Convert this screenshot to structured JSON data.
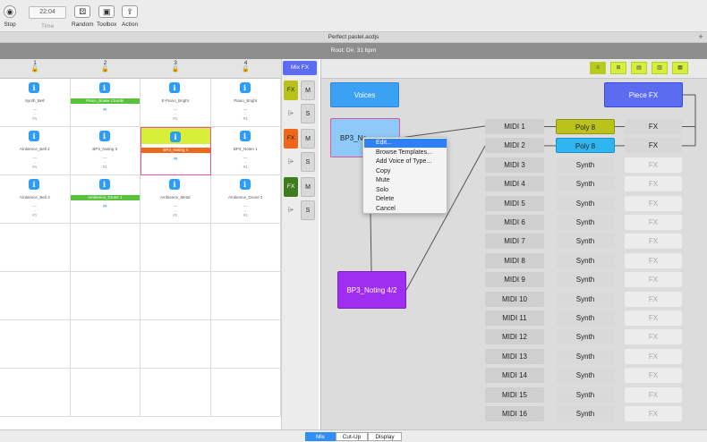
{
  "toolbar": {
    "stop_label": "Stop",
    "time_value": "22:04",
    "time_label": "Time",
    "random_label": "Random",
    "toolbox_label": "Toolbox",
    "action_label": "Action"
  },
  "title": "Perfect pastel.acdjs",
  "root": "Root: D#, 31 bpm",
  "plus": "+",
  "grid": {
    "columns": [
      {
        "num": "1",
        "lock": "🔓"
      },
      {
        "num": "2",
        "lock": "🔓"
      },
      {
        "num": "3",
        "lock": "🔒"
      },
      {
        "num": "4",
        "lock": "🔓"
      }
    ],
    "cells": [
      {
        "name": "Synth_Bell",
        "marks": [
          "—",
          "◦",
          "#1"
        ]
      },
      {
        "name": "Piano_Bowie Chords",
        "style": "g",
        "loop": "∞"
      },
      {
        "name": "E-Piano_Bright",
        "marks": [
          "—",
          "◦",
          "#1"
        ]
      },
      {
        "name": "Piano_Bright",
        "marks": [
          "—",
          "◦",
          "#1"
        ]
      },
      {
        "name": "Ambience_Bell 2",
        "marks": [
          "—",
          "◦",
          "#1"
        ]
      },
      {
        "name": "BP3_Noting 3",
        "marks": [
          "—",
          "◦",
          "#1"
        ]
      },
      {
        "name": "BP3_Noting 4",
        "style": "o",
        "loop": "∞",
        "selected": true
      },
      {
        "name": "BP3_Noten 1",
        "marks": [
          "—",
          "◦",
          "#1"
        ]
      },
      {
        "name": "Ambience_Bell 3",
        "marks": [
          "—",
          "◦",
          "#1"
        ]
      },
      {
        "name": "Ambience_Drone 1",
        "style": "g",
        "loop": "∞"
      },
      {
        "name": "Ambience_Metal",
        "marks": [
          "—",
          "◦",
          "#1"
        ]
      },
      {
        "name": "Ambience_Drone 2",
        "marks": [
          "—",
          "◦",
          "#1"
        ]
      }
    ],
    "info_glyph": "i"
  },
  "side": {
    "mix_fx": "Mix FX",
    "rows": [
      {
        "fx": "FX",
        "fx_color": "#b8c21a",
        "m": "M",
        "s": "S"
      },
      {
        "fx": "FX",
        "fx_color": "#f0661a",
        "m": "M",
        "s": "S"
      },
      {
        "fx": "FX",
        "fx_color": "#3e7d1e",
        "m": "M",
        "s": "S"
      }
    ]
  },
  "graph": {
    "tabs": [
      "≡",
      "⊞",
      "▤",
      "▥",
      "▦"
    ],
    "voices": "Voices",
    "piece_fx": "Piece FX",
    "bp3_noting": "BP3_No",
    "bp3_noting_42": "BP3_Noting 4/2",
    "midi": [
      "MIDI 1",
      "MIDI 2",
      "MIDI 3",
      "MIDI 4",
      "MIDI 5",
      "MIDI 6",
      "MIDI 7",
      "MIDI 8",
      "MIDI 9",
      "MIDI 10",
      "MIDI 11",
      "MIDI 12",
      "MIDI 13",
      "MIDI 14",
      "MIDI 15",
      "MIDI 16"
    ],
    "synth": [
      "Poly 8",
      "Poly 8",
      "Synth",
      "Synth",
      "Synth",
      "Synth",
      "Synth",
      "Synth",
      "Synth",
      "Synth",
      "Synth",
      "Synth",
      "Synth",
      "Synth",
      "Synth",
      "Synth"
    ],
    "fx": [
      "FX",
      "FX",
      "FX",
      "FX",
      "FX",
      "FX",
      "FX",
      "FX",
      "FX",
      "FX",
      "FX",
      "FX",
      "FX",
      "FX",
      "FX",
      "FX"
    ],
    "colors": {
      "voices": "#3ba1f5",
      "piece_fx": "#5b6cf0",
      "bp3_a": "#8fc9f7",
      "bp3_b": "#a02ef0",
      "poly1": "#bcc21c",
      "poly2": "#2fb6f0"
    }
  },
  "context_menu": [
    "Edit...",
    "Browse Templates...",
    "Add Voice of Type...",
    "Copy",
    "Mute",
    "Solo",
    "Delete",
    "Cancel"
  ],
  "bottom_tabs": [
    "Mix",
    "Cut-Up",
    "Display"
  ]
}
